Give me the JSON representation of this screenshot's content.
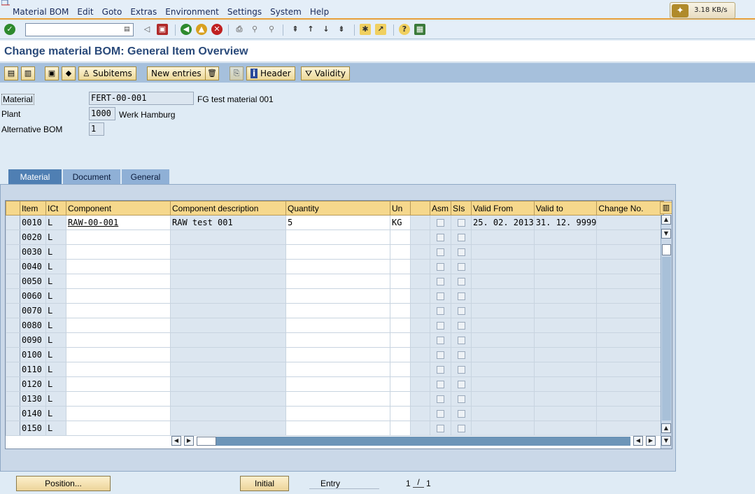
{
  "menu": [
    "Material BOM",
    "Edit",
    "Goto",
    "Extras",
    "Environment",
    "Settings",
    "System",
    "Help"
  ],
  "speed_widget": "3.18 KB/s",
  "title": "Change material BOM: General Item Overview",
  "app_toolbar": {
    "subitems": "Subitems",
    "new_entries": "New entries",
    "header": "Header",
    "validity": "Validity"
  },
  "fields": {
    "material_label": "Material",
    "material_value": "FERT-00-001",
    "material_desc": "FG test material 001",
    "plant_label": "Plant",
    "plant_value": "1000",
    "plant_desc": "Werk Hamburg",
    "altbom_label": "Alternative BOM",
    "altbom_value": "1"
  },
  "tabs": [
    "Material",
    "Document",
    "General"
  ],
  "table": {
    "headers": [
      "Item",
      "ICt",
      "Component",
      "Component description",
      "Quantity",
      "Un",
      "",
      "Asm",
      "SIs",
      "Valid From",
      "Valid to",
      "Change No."
    ],
    "rows": [
      {
        "item": "0010",
        "ict": "L",
        "component": "RAW-00-001",
        "desc": "RAW test 001",
        "qty": "5",
        "un": "KG",
        "from": "25. 02. 2013",
        "to": "31. 12. 9999"
      },
      {
        "item": "0020",
        "ict": "L",
        "component": "",
        "desc": "",
        "qty": "",
        "un": "",
        "from": "",
        "to": ""
      },
      {
        "item": "0030",
        "ict": "L",
        "component": "",
        "desc": "",
        "qty": "",
        "un": "",
        "from": "",
        "to": ""
      },
      {
        "item": "0040",
        "ict": "L",
        "component": "",
        "desc": "",
        "qty": "",
        "un": "",
        "from": "",
        "to": ""
      },
      {
        "item": "0050",
        "ict": "L",
        "component": "",
        "desc": "",
        "qty": "",
        "un": "",
        "from": "",
        "to": ""
      },
      {
        "item": "0060",
        "ict": "L",
        "component": "",
        "desc": "",
        "qty": "",
        "un": "",
        "from": "",
        "to": ""
      },
      {
        "item": "0070",
        "ict": "L",
        "component": "",
        "desc": "",
        "qty": "",
        "un": "",
        "from": "",
        "to": ""
      },
      {
        "item": "0080",
        "ict": "L",
        "component": "",
        "desc": "",
        "qty": "",
        "un": "",
        "from": "",
        "to": ""
      },
      {
        "item": "0090",
        "ict": "L",
        "component": "",
        "desc": "",
        "qty": "",
        "un": "",
        "from": "",
        "to": ""
      },
      {
        "item": "0100",
        "ict": "L",
        "component": "",
        "desc": "",
        "qty": "",
        "un": "",
        "from": "",
        "to": ""
      },
      {
        "item": "0110",
        "ict": "L",
        "component": "",
        "desc": "",
        "qty": "",
        "un": "",
        "from": "",
        "to": ""
      },
      {
        "item": "0120",
        "ict": "L",
        "component": "",
        "desc": "",
        "qty": "",
        "un": "",
        "from": "",
        "to": ""
      },
      {
        "item": "0130",
        "ict": "L",
        "component": "",
        "desc": "",
        "qty": "",
        "un": "",
        "from": "",
        "to": ""
      },
      {
        "item": "0140",
        "ict": "L",
        "component": "",
        "desc": "",
        "qty": "",
        "un": "",
        "from": "",
        "to": ""
      },
      {
        "item": "0150",
        "ict": "L",
        "component": "",
        "desc": "",
        "qty": "",
        "un": "",
        "from": "",
        "to": ""
      }
    ]
  },
  "footer": {
    "position_button": "Position...",
    "initial_button": "Initial",
    "entry_label": "Entry",
    "page_current": "1",
    "page_sep": "/",
    "page_total": "1"
  },
  "colors": {
    "accent_orange": "#e8a03a",
    "title_blue": "#2a4a7a",
    "toolbar_blue": "#a6c0dc",
    "header_yellow": "#f6d88c"
  }
}
